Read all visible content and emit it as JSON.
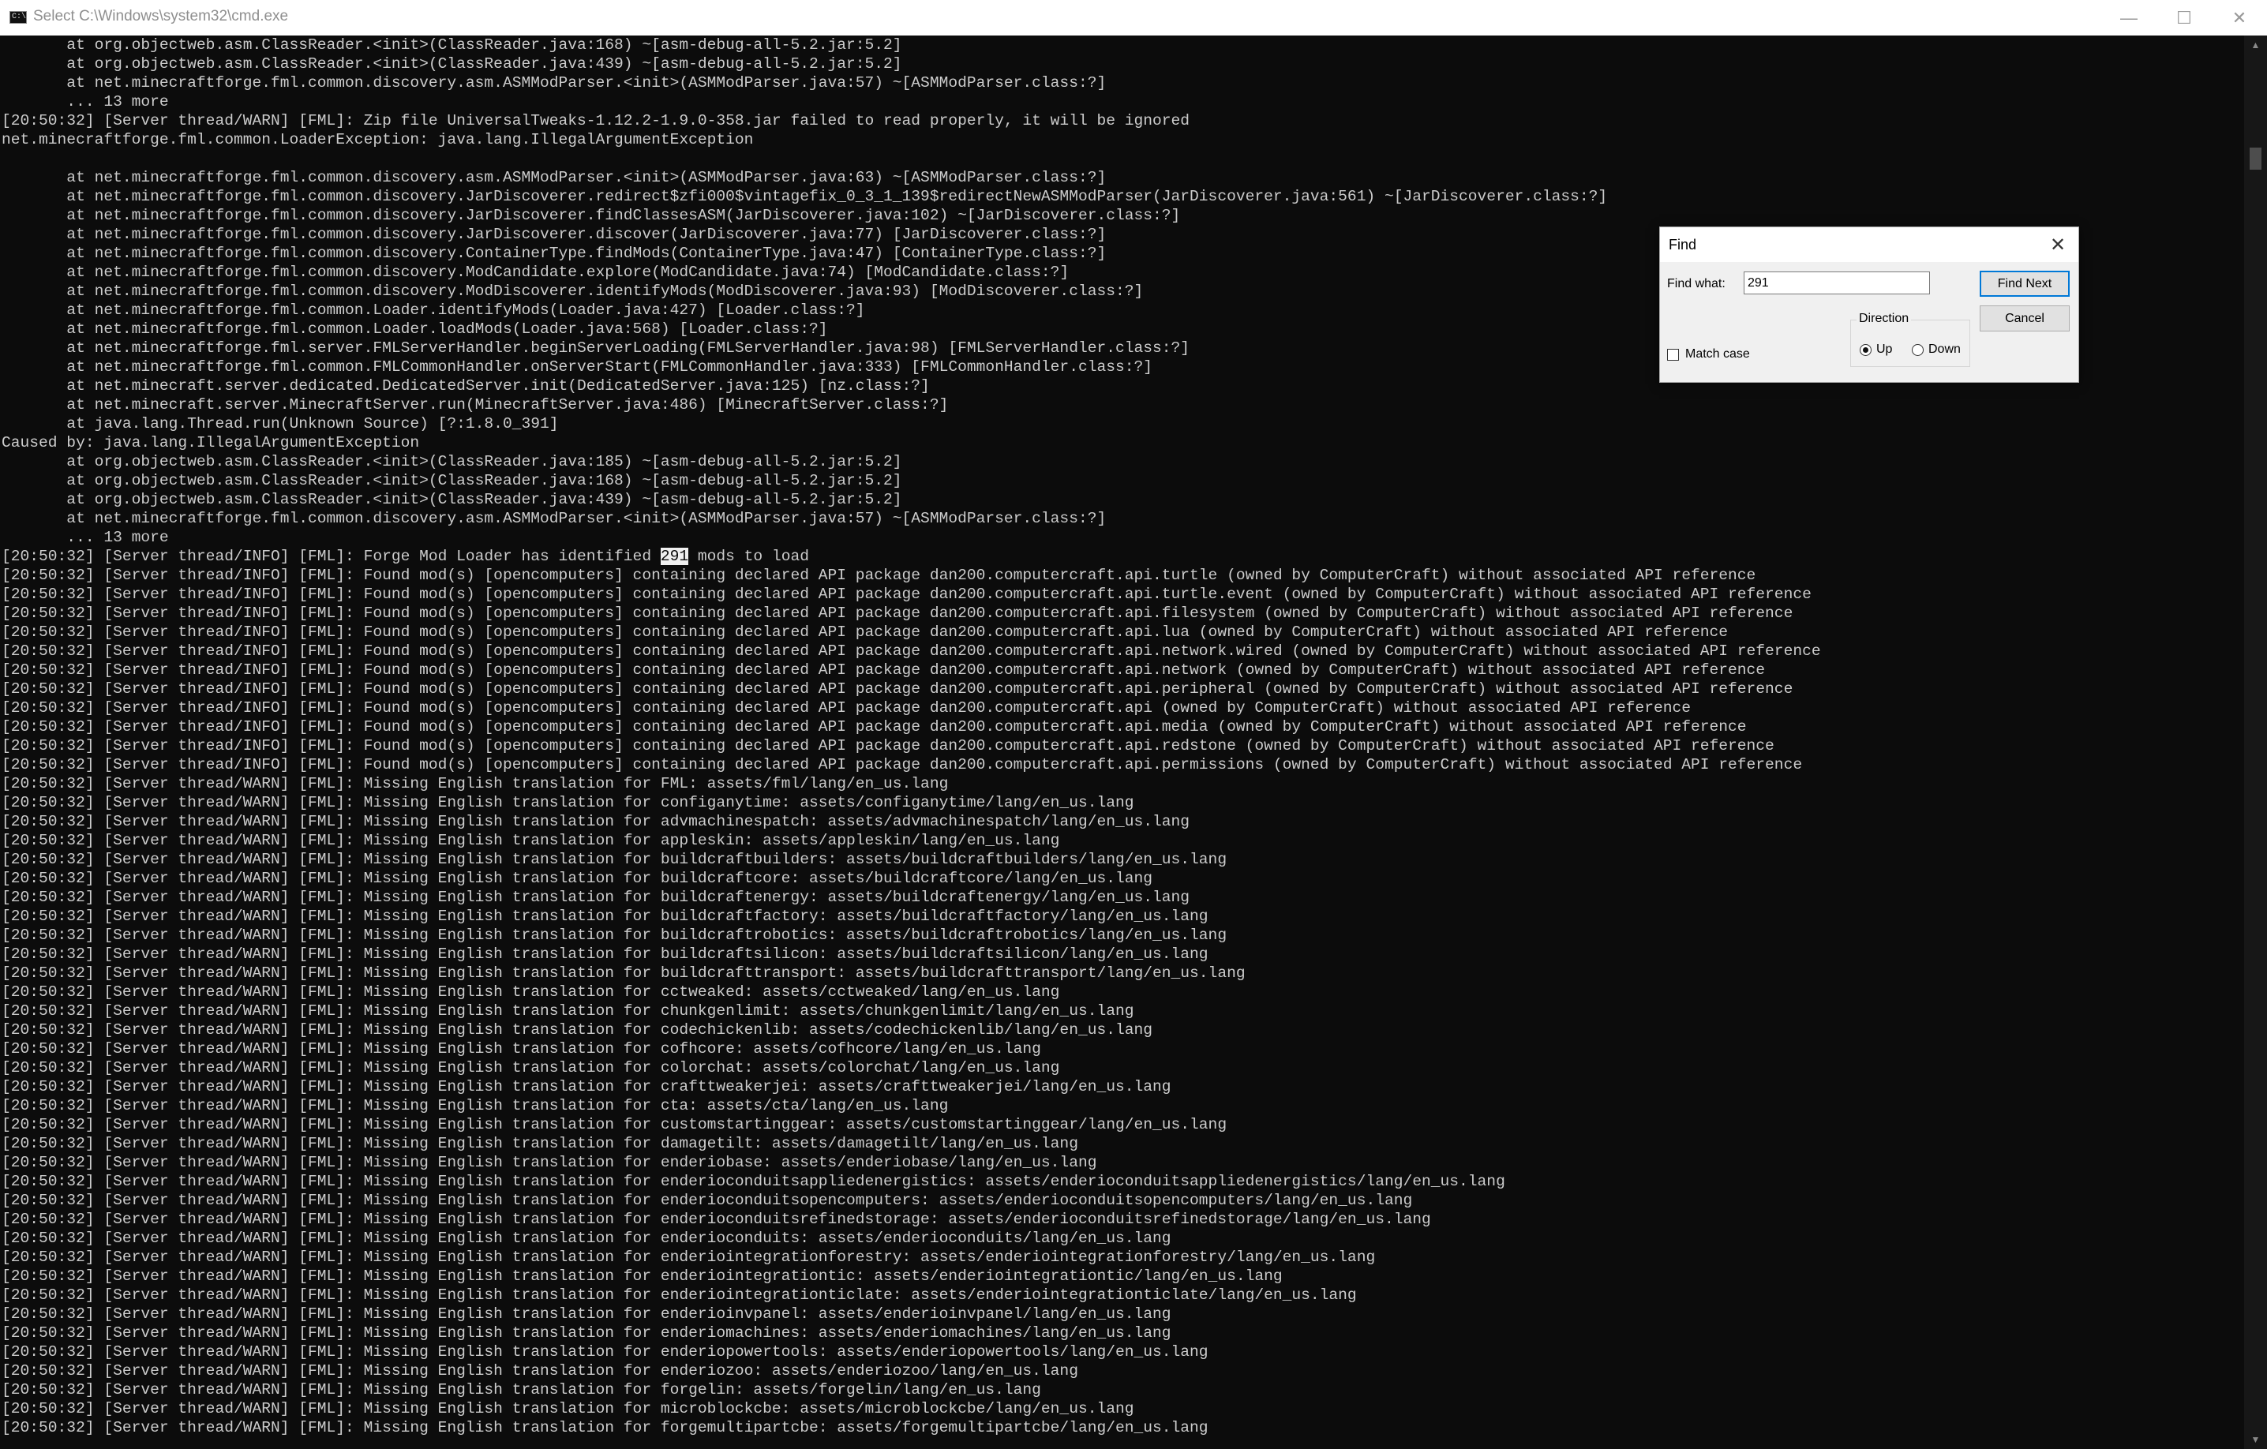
{
  "window": {
    "title": "Select C:\\Windows\\system32\\cmd.exe",
    "icon_text": "C:\\",
    "minimize_label": "—",
    "maximize_label": "☐",
    "close_label": "✕"
  },
  "terminal": {
    "lines": [
      {
        "text": "       at org.objectweb.asm.ClassReader.<init>(ClassReader.java:168) ~[asm-debug-all-5.2.jar:5.2]"
      },
      {
        "text": "       at org.objectweb.asm.ClassReader.<init>(ClassReader.java:439) ~[asm-debug-all-5.2.jar:5.2]"
      },
      {
        "text": "       at net.minecraftforge.fml.common.discovery.asm.ASMModParser.<init>(ASMModParser.java:57) ~[ASMModParser.class:?]"
      },
      {
        "text": "       ... 13 more"
      },
      {
        "text": "[20:50:32] [Server thread/WARN] [FML]: Zip file UniversalTweaks-1.12.2-1.9.0-358.jar failed to read properly, it will be ignored"
      },
      {
        "text": "net.minecraftforge.fml.common.LoaderException: java.lang.IllegalArgumentException"
      },
      {
        "text": ""
      },
      {
        "text": "       at net.minecraftforge.fml.common.discovery.asm.ASMModParser.<init>(ASMModParser.java:63) ~[ASMModParser.class:?]"
      },
      {
        "text": "       at net.minecraftforge.fml.common.discovery.JarDiscoverer.redirect$zfi000$vintagefix_0_3_1_139$redirectNewASMModParser(JarDiscoverer.java:561) ~[JarDiscoverer.class:?]"
      },
      {
        "text": "       at net.minecraftforge.fml.common.discovery.JarDiscoverer.findClassesASM(JarDiscoverer.java:102) ~[JarDiscoverer.class:?]"
      },
      {
        "text": "       at net.minecraftforge.fml.common.discovery.JarDiscoverer.discover(JarDiscoverer.java:77) [JarDiscoverer.class:?]"
      },
      {
        "text": "       at net.minecraftforge.fml.common.discovery.ContainerType.findMods(ContainerType.java:47) [ContainerType.class:?]"
      },
      {
        "text": "       at net.minecraftforge.fml.common.discovery.ModCandidate.explore(ModCandidate.java:74) [ModCandidate.class:?]"
      },
      {
        "text": "       at net.minecraftforge.fml.common.discovery.ModDiscoverer.identifyMods(ModDiscoverer.java:93) [ModDiscoverer.class:?]"
      },
      {
        "text": "       at net.minecraftforge.fml.common.Loader.identifyMods(Loader.java:427) [Loader.class:?]"
      },
      {
        "text": "       at net.minecraftforge.fml.common.Loader.loadMods(Loader.java:568) [Loader.class:?]"
      },
      {
        "text": "       at net.minecraftforge.fml.server.FMLServerHandler.beginServerLoading(FMLServerHandler.java:98) [FMLServerHandler.class:?]"
      },
      {
        "text": "       at net.minecraftforge.fml.common.FMLCommonHandler.onServerStart(FMLCommonHandler.java:333) [FMLCommonHandler.class:?]"
      },
      {
        "text": "       at net.minecraft.server.dedicated.DedicatedServer.init(DedicatedServer.java:125) [nz.class:?]"
      },
      {
        "text": "       at net.minecraft.server.MinecraftServer.run(MinecraftServer.java:486) [MinecraftServer.class:?]"
      },
      {
        "text": "       at java.lang.Thread.run(Unknown Source) [?:1.8.0_391]"
      },
      {
        "text": "Caused by: java.lang.IllegalArgumentException"
      },
      {
        "text": "       at org.objectweb.asm.ClassReader.<init>(ClassReader.java:185) ~[asm-debug-all-5.2.jar:5.2]"
      },
      {
        "text": "       at org.objectweb.asm.ClassReader.<init>(ClassReader.java:168) ~[asm-debug-all-5.2.jar:5.2]"
      },
      {
        "text": "       at org.objectweb.asm.ClassReader.<init>(ClassReader.java:439) ~[asm-debug-all-5.2.jar:5.2]"
      },
      {
        "text": "       at net.minecraftforge.fml.common.discovery.asm.ASMModParser.<init>(ASMModParser.java:57) ~[ASMModParser.class:?]"
      },
      {
        "text": "       ... 13 more"
      },
      {
        "pre": "[20:50:32] [Server thread/INFO] [FML]: Forge Mod Loader has identified ",
        "hl": "291",
        "post": " mods to load"
      },
      {
        "text": "[20:50:32] [Server thread/INFO] [FML]: Found mod(s) [opencomputers] containing declared API package dan200.computercraft.api.turtle (owned by ComputerCraft) without associated API reference"
      },
      {
        "text": "[20:50:32] [Server thread/INFO] [FML]: Found mod(s) [opencomputers] containing declared API package dan200.computercraft.api.turtle.event (owned by ComputerCraft) without associated API reference"
      },
      {
        "text": "[20:50:32] [Server thread/INFO] [FML]: Found mod(s) [opencomputers] containing declared API package dan200.computercraft.api.filesystem (owned by ComputerCraft) without associated API reference"
      },
      {
        "text": "[20:50:32] [Server thread/INFO] [FML]: Found mod(s) [opencomputers] containing declared API package dan200.computercraft.api.lua (owned by ComputerCraft) without associated API reference"
      },
      {
        "text": "[20:50:32] [Server thread/INFO] [FML]: Found mod(s) [opencomputers] containing declared API package dan200.computercraft.api.network.wired (owned by ComputerCraft) without associated API reference"
      },
      {
        "text": "[20:50:32] [Server thread/INFO] [FML]: Found mod(s) [opencomputers] containing declared API package dan200.computercraft.api.network (owned by ComputerCraft) without associated API reference"
      },
      {
        "text": "[20:50:32] [Server thread/INFO] [FML]: Found mod(s) [opencomputers] containing declared API package dan200.computercraft.api.peripheral (owned by ComputerCraft) without associated API reference"
      },
      {
        "text": "[20:50:32] [Server thread/INFO] [FML]: Found mod(s) [opencomputers] containing declared API package dan200.computercraft.api (owned by ComputerCraft) without associated API reference"
      },
      {
        "text": "[20:50:32] [Server thread/INFO] [FML]: Found mod(s) [opencomputers] containing declared API package dan200.computercraft.api.media (owned by ComputerCraft) without associated API reference"
      },
      {
        "text": "[20:50:32] [Server thread/INFO] [FML]: Found mod(s) [opencomputers] containing declared API package dan200.computercraft.api.redstone (owned by ComputerCraft) without associated API reference"
      },
      {
        "text": "[20:50:32] [Server thread/INFO] [FML]: Found mod(s) [opencomputers] containing declared API package dan200.computercraft.api.permissions (owned by ComputerCraft) without associated API reference"
      },
      {
        "text": "[20:50:32] [Server thread/WARN] [FML]: Missing English translation for FML: assets/fml/lang/en_us.lang"
      },
      {
        "text": "[20:50:32] [Server thread/WARN] [FML]: Missing English translation for configanytime: assets/configanytime/lang/en_us.lang"
      },
      {
        "text": "[20:50:32] [Server thread/WARN] [FML]: Missing English translation for advmachinespatch: assets/advmachinespatch/lang/en_us.lang"
      },
      {
        "text": "[20:50:32] [Server thread/WARN] [FML]: Missing English translation for appleskin: assets/appleskin/lang/en_us.lang"
      },
      {
        "text": "[20:50:32] [Server thread/WARN] [FML]: Missing English translation for buildcraftbuilders: assets/buildcraftbuilders/lang/en_us.lang"
      },
      {
        "text": "[20:50:32] [Server thread/WARN] [FML]: Missing English translation for buildcraftcore: assets/buildcraftcore/lang/en_us.lang"
      },
      {
        "text": "[20:50:32] [Server thread/WARN] [FML]: Missing English translation for buildcraftenergy: assets/buildcraftenergy/lang/en_us.lang"
      },
      {
        "text": "[20:50:32] [Server thread/WARN] [FML]: Missing English translation for buildcraftfactory: assets/buildcraftfactory/lang/en_us.lang"
      },
      {
        "text": "[20:50:32] [Server thread/WARN] [FML]: Missing English translation for buildcraftrobotics: assets/buildcraftrobotics/lang/en_us.lang"
      },
      {
        "text": "[20:50:32] [Server thread/WARN] [FML]: Missing English translation for buildcraftsilicon: assets/buildcraftsilicon/lang/en_us.lang"
      },
      {
        "text": "[20:50:32] [Server thread/WARN] [FML]: Missing English translation for buildcrafttransport: assets/buildcrafttransport/lang/en_us.lang"
      },
      {
        "text": "[20:50:32] [Server thread/WARN] [FML]: Missing English translation for cctweaked: assets/cctweaked/lang/en_us.lang"
      },
      {
        "text": "[20:50:32] [Server thread/WARN] [FML]: Missing English translation for chunkgenlimit: assets/chunkgenlimit/lang/en_us.lang"
      },
      {
        "text": "[20:50:32] [Server thread/WARN] [FML]: Missing English translation for codechickenlib: assets/codechickenlib/lang/en_us.lang"
      },
      {
        "text": "[20:50:32] [Server thread/WARN] [FML]: Missing English translation for cofhcore: assets/cofhcore/lang/en_us.lang"
      },
      {
        "text": "[20:50:32] [Server thread/WARN] [FML]: Missing English translation for colorchat: assets/colorchat/lang/en_us.lang"
      },
      {
        "text": "[20:50:32] [Server thread/WARN] [FML]: Missing English translation for crafttweakerjei: assets/crafttweakerjei/lang/en_us.lang"
      },
      {
        "text": "[20:50:32] [Server thread/WARN] [FML]: Missing English translation for cta: assets/cta/lang/en_us.lang"
      },
      {
        "text": "[20:50:32] [Server thread/WARN] [FML]: Missing English translation for customstartinggear: assets/customstartinggear/lang/en_us.lang"
      },
      {
        "text": "[20:50:32] [Server thread/WARN] [FML]: Missing English translation for damagetilt: assets/damagetilt/lang/en_us.lang"
      },
      {
        "text": "[20:50:32] [Server thread/WARN] [FML]: Missing English translation for enderiobase: assets/enderiobase/lang/en_us.lang"
      },
      {
        "text": "[20:50:32] [Server thread/WARN] [FML]: Missing English translation for enderioconduitsappliedenergistics: assets/enderioconduitsappliedenergistics/lang/en_us.lang"
      },
      {
        "text": "[20:50:32] [Server thread/WARN] [FML]: Missing English translation for enderioconduitsopencomputers: assets/enderioconduitsopencomputers/lang/en_us.lang"
      },
      {
        "text": "[20:50:32] [Server thread/WARN] [FML]: Missing English translation for enderioconduitsrefinedstorage: assets/enderioconduitsrefinedstorage/lang/en_us.lang"
      },
      {
        "text": "[20:50:32] [Server thread/WARN] [FML]: Missing English translation for enderioconduits: assets/enderioconduits/lang/en_us.lang"
      },
      {
        "text": "[20:50:32] [Server thread/WARN] [FML]: Missing English translation for enderiointegrationforestry: assets/enderiointegrationforestry/lang/en_us.lang"
      },
      {
        "text": "[20:50:32] [Server thread/WARN] [FML]: Missing English translation for enderiointegrationtic: assets/enderiointegrationtic/lang/en_us.lang"
      },
      {
        "text": "[20:50:32] [Server thread/WARN] [FML]: Missing English translation for enderiointegrationticlate: assets/enderiointegrationticlate/lang/en_us.lang"
      },
      {
        "text": "[20:50:32] [Server thread/WARN] [FML]: Missing English translation for enderioinvpanel: assets/enderioinvpanel/lang/en_us.lang"
      },
      {
        "text": "[20:50:32] [Server thread/WARN] [FML]: Missing English translation for enderiomachines: assets/enderiomachines/lang/en_us.lang"
      },
      {
        "text": "[20:50:32] [Server thread/WARN] [FML]: Missing English translation for enderiopowertools: assets/enderiopowertools/lang/en_us.lang"
      },
      {
        "text": "[20:50:32] [Server thread/WARN] [FML]: Missing English translation for enderiozoo: assets/enderiozoo/lang/en_us.lang"
      },
      {
        "text": "[20:50:32] [Server thread/WARN] [FML]: Missing English translation for forgelin: assets/forgelin/lang/en_us.lang"
      },
      {
        "text": "[20:50:32] [Server thread/WARN] [FML]: Missing English translation for microblockcbe: assets/microblockcbe/lang/en_us.lang"
      },
      {
        "text": "[20:50:32] [Server thread/WARN] [FML]: Missing English translation for forgemultipartcbe: assets/forgemultipartcbe/lang/en_us.lang"
      }
    ]
  },
  "find_dialog": {
    "title": "Find",
    "close_label": "✕",
    "find_what_label": "Find what:",
    "find_what_value": "291",
    "find_next_label": "Find Next",
    "cancel_label": "Cancel",
    "match_case_label": "Match case",
    "match_case_checked": false,
    "direction_label": "Direction",
    "up_label": "Up",
    "down_label": "Down",
    "direction_selected": "Up"
  },
  "colors": {
    "terminal_bg": "#0c0c0c",
    "terminal_fg": "#cccccc",
    "highlight_bg": "#f0f0f0",
    "dialog_bg": "#f0f0f0",
    "default_button_border": "#0078d7"
  }
}
